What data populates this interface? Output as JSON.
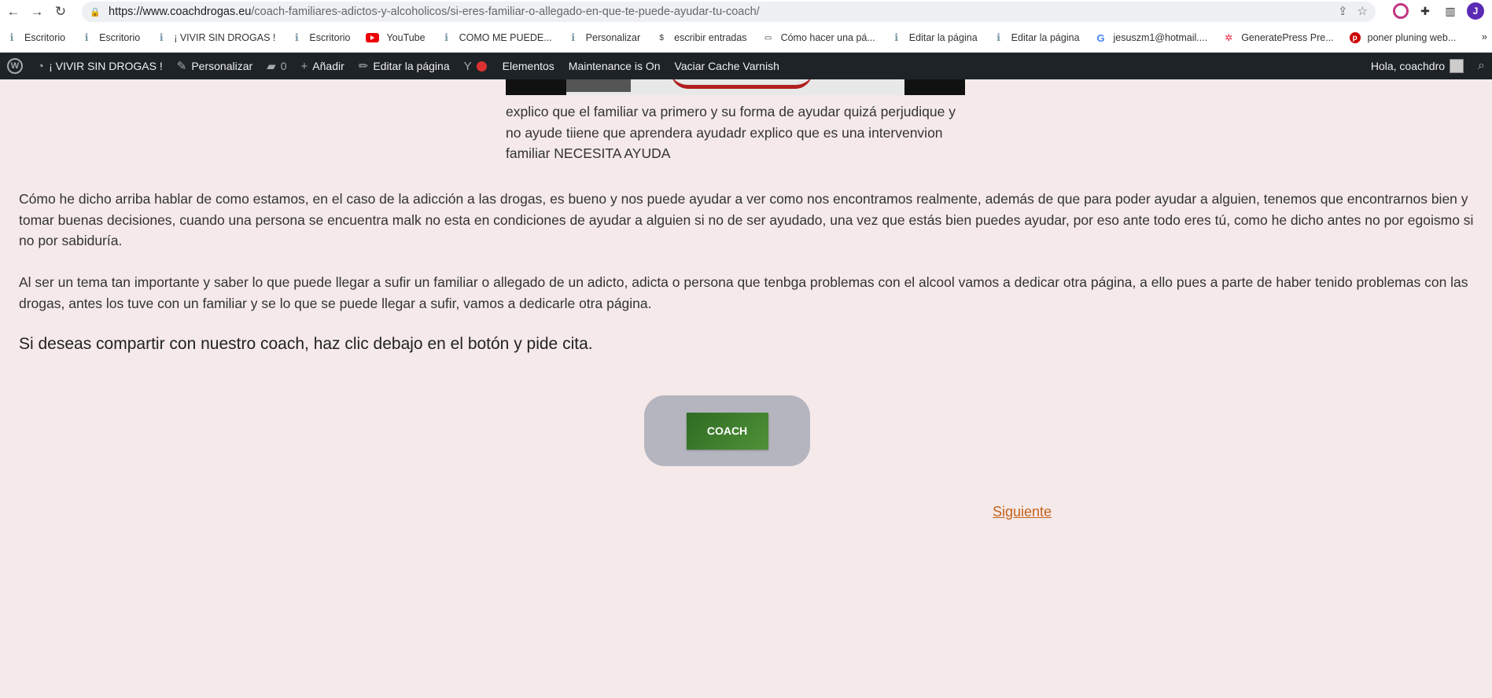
{
  "browser": {
    "url_host": "https://www.coachdrogas.eu",
    "url_path": "/coach-familiares-adictos-y-alcoholicos/si-eres-familiar-o-allegado-en-que-te-puede-ayudar-tu-coach/",
    "profile_initial": "J"
  },
  "bookmarks": [
    {
      "label": "Escritorio",
      "icon": "wp"
    },
    {
      "label": "Escritorio",
      "icon": "wp"
    },
    {
      "label": "¡ VIVIR SIN DROGAS !",
      "icon": "wp"
    },
    {
      "label": "Escritorio",
      "icon": "wp"
    },
    {
      "label": "YouTube",
      "icon": "youtube"
    },
    {
      "label": "COMO ME PUEDE...",
      "icon": "wp"
    },
    {
      "label": "Personalizar",
      "icon": "wp"
    },
    {
      "label": "escribir entradas",
      "icon": "dollar"
    },
    {
      "label": "Cómo hacer una pá...",
      "icon": "page"
    },
    {
      "label": "Editar la página",
      "icon": "wp"
    },
    {
      "label": "Editar la página",
      "icon": "wp"
    },
    {
      "label": "jesuszm1@hotmail....",
      "icon": "google"
    },
    {
      "label": "GeneratePress Pre...",
      "icon": "generatepress"
    },
    {
      "label": "poner pluning web...",
      "icon": "pinterest"
    }
  ],
  "adminbar": {
    "site": "¡ VIVIR SIN DROGAS !",
    "customize": "Personalizar",
    "comments": "0",
    "add": "Añadir",
    "edit": "Editar la página",
    "elements": "Elementos",
    "maintenance": "Maintenance is On",
    "cache": "Vaciar Cache Varnish",
    "greeting": "Hola, coachdro"
  },
  "content": {
    "caption": "explico que el familiar va primero y su forma de ayudar quizá perjudique y no ayude tiiene que aprendera ayudadr explico que es una intervenvion familiar NECESITA AYUDA",
    "paragraph1": "Cómo he dicho arriba hablar de como estamos, en el caso de la adicción a las drogas, es bueno y nos puede ayudar a ver como nos encontramos realmente, además de que para poder ayudar a alguien, tenemos que encontrarnos bien y tomar buenas decisiones, cuando una persona se encuentra malk no esta en condiciones de ayudar a alguien si no de ser ayudado, una vez que estás bien puedes ayudar, por eso ante todo eres tú, como he dicho antes no por egoismo si no por sabiduría.",
    "paragraph2": "Al ser un tema tan importante y saber lo que puede llegar a sufir un familiar o allegado de un adicto, adicta o persona que tenbga problemas con el alcool vamos a dedicar otra página, a ello pues a parte de haber tenido problemas con las drogas, antes los tuve con un familiar y se lo que se puede llegar a sufir, vamos a dedicarle otra página.",
    "lead": "Si deseas compartir con nuestro coach, haz clic debajo en el botón y pide cita.",
    "button": "COACH",
    "next": "Siguiente"
  }
}
